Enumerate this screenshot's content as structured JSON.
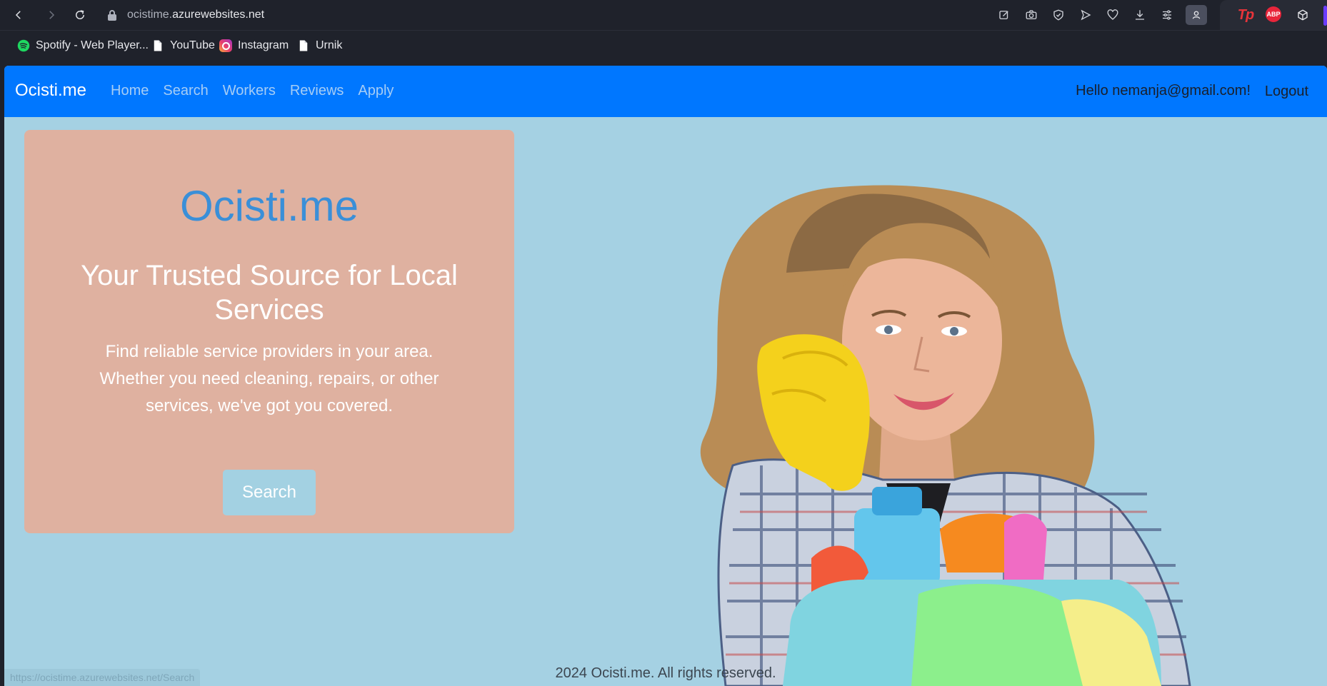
{
  "browser": {
    "url_prefix": "ocistime.",
    "url_domain": "azurewebsites.net",
    "bookmarks": [
      {
        "label": "Spotify - Web Player...",
        "icon": "spotify-icon"
      },
      {
        "label": "YouTube",
        "icon": "page-icon"
      },
      {
        "label": "Instagram",
        "icon": "instagram-icon"
      },
      {
        "label": "Urnik",
        "icon": "page-icon"
      }
    ],
    "extensions": {
      "tp": "Tp",
      "abp": "ABP"
    },
    "status_url": "https://ocistime.azurewebsites.net/Search"
  },
  "site": {
    "brand": "Ocisti.me",
    "nav": [
      "Home",
      "Search",
      "Workers",
      "Reviews",
      "Apply"
    ],
    "greeting": "Hello nemanja@gmail.com!",
    "logout": "Logout"
  },
  "hero": {
    "title": "Ocisti.me",
    "subtitle": "Your Trusted Source for Local Services",
    "description": "Find reliable service providers in your area. Whether you need cleaning, repairs, or other services, we've got you covered.",
    "button": "Search"
  },
  "footer": "2024 Ocisti.me. All rights reserved.",
  "colors": {
    "navbar": "#0077ff",
    "page_bg": "#a5d1e3",
    "card_bg": "#dfb1a0",
    "title": "#3a8fd8",
    "button": "#a3d1e2"
  }
}
